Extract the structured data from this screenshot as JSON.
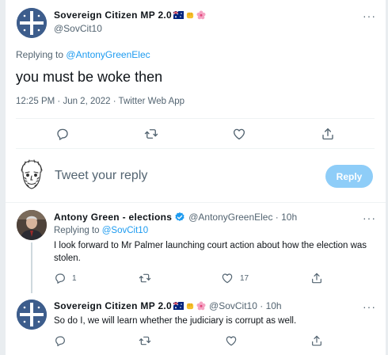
{
  "main_tweet": {
    "display_name": "Sovereign Citizen MP 2.0",
    "handle": "@SovCit10",
    "replying_label": "Replying to",
    "replying_to": "@AntonyGreenElec",
    "text": "you must be woke then",
    "meta": "12:25 PM · Jun 2, 2022 · Twitter Web App",
    "emoji_icons": [
      "australian-flag-icon",
      "raised-fist-icon",
      "cherry-blossom-icon"
    ]
  },
  "composer": {
    "placeholder": "Tweet your reply",
    "reply_label": "Reply",
    "button_color": "#8ecdf8"
  },
  "replies": [
    {
      "display_name": "Antony Green - elections",
      "handle_time": "@AntonyGreenElec · 10h",
      "verified": true,
      "replying_label": "Replying to",
      "replying_to": "@SovCit10",
      "text": "I look forward to Mr Palmer launching court action about how the election was stolen.",
      "reply_count": "1",
      "like_count": "17"
    },
    {
      "display_name": "Sovereign Citizen MP 2.0",
      "handle_time": "@SovCit10 · 10h",
      "text": "So do I, we will learn whether the judiciary is corrupt as well."
    }
  ],
  "colors": {
    "accent": "#1d9bf0",
    "text": "#0f1419",
    "muted": "#536471",
    "divider": "#eff3f4"
  }
}
